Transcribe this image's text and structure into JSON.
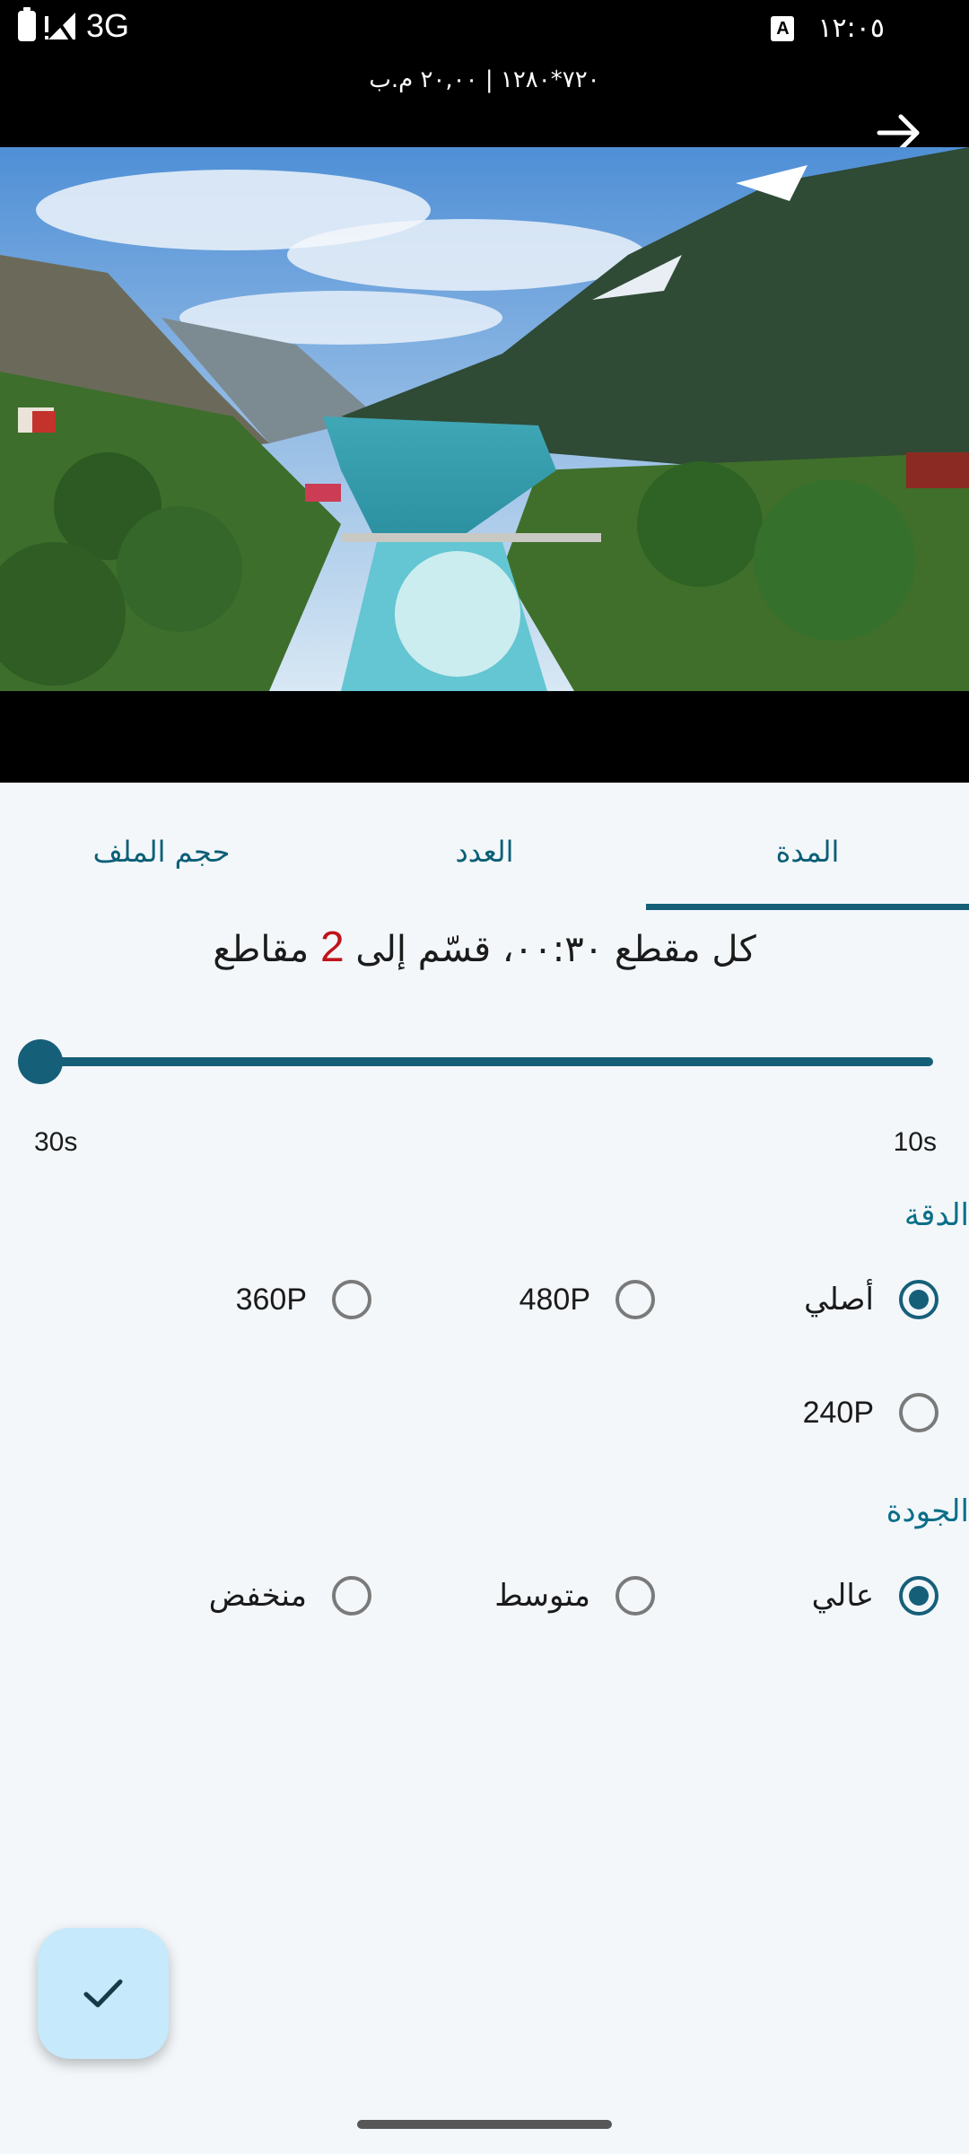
{
  "status_bar": {
    "network": "3G",
    "time": "١٢:٠٥",
    "keyboard_indicator": "A",
    "icons": [
      "battery-icon",
      "signal-icon",
      "keyboard-icon"
    ]
  },
  "header": {
    "video_info": "٧٢٠*١٢٨٠ | ٢٠,٠٠ م.ب",
    "back_icon": "arrow-right-icon"
  },
  "tabs": [
    {
      "label": "المدة",
      "selected": true
    },
    {
      "label": "العدد",
      "selected": false
    },
    {
      "label": "حجم الملف",
      "selected": false
    }
  ],
  "split": {
    "prefix": "كل مقطع ٠٠:٣٠، قسّم إلى",
    "count": "2",
    "suffix": "مقاطع"
  },
  "slider": {
    "min_label": "30s",
    "max_label": "10s",
    "value_fraction": 0
  },
  "resolution": {
    "title": "الدقة",
    "options": [
      {
        "label": "أصلي",
        "checked": true
      },
      {
        "label": "480P",
        "checked": false
      },
      {
        "label": "360P",
        "checked": false
      },
      {
        "label": "240P",
        "checked": false
      }
    ]
  },
  "quality": {
    "title": "الجودة",
    "options": [
      {
        "label": "عالي",
        "checked": true
      },
      {
        "label": "متوسط",
        "checked": false
      },
      {
        "label": "منخفض",
        "checked": false
      }
    ]
  },
  "fab": {
    "icon": "check-icon"
  },
  "colors": {
    "accent": "#155f79",
    "tab_text": "#0b5f76",
    "count_highlight": "#c0141b",
    "fab_background": "#c6e9fb"
  }
}
